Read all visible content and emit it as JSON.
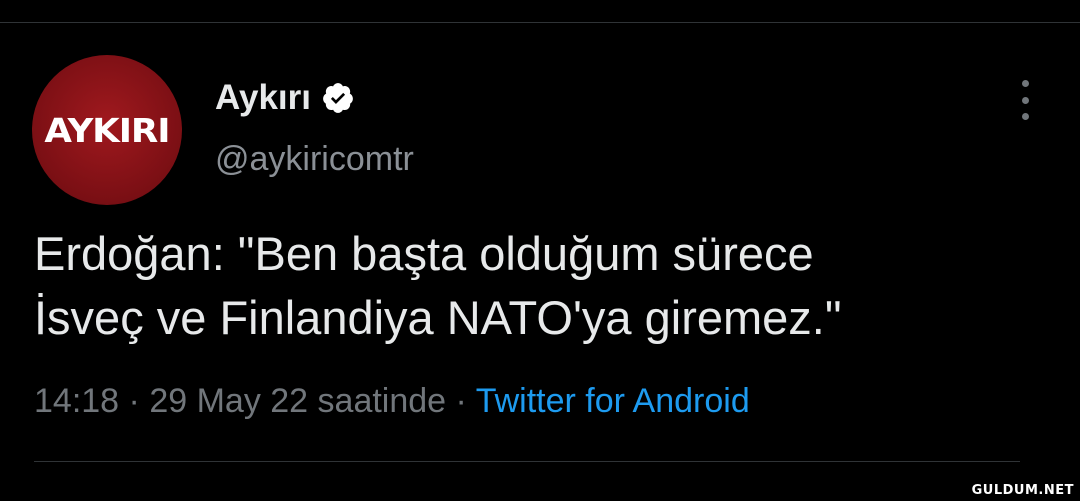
{
  "account": {
    "avatar_text": "AYKIRI",
    "display_name": "Aykırı",
    "handle": "@aykiricomtr",
    "verified_icon": "verified-badge-icon"
  },
  "tweet": {
    "line1": "Erdoğan: \"Ben başta olduğum sürece",
    "line2": "İsveç ve Finlandiya NATO'ya giremez.\"",
    "time": "14:18",
    "separator": "·",
    "date": "29 May 22 saatinde",
    "source": "Twitter for Android"
  },
  "more_icon": "more-vertical-icon",
  "watermark": "GULDUM.NET",
  "colors": {
    "background": "#000000",
    "text": "#e7e9ea",
    "muted": "#71767b",
    "link": "#1d9bf0",
    "avatar": "#8f1419"
  }
}
